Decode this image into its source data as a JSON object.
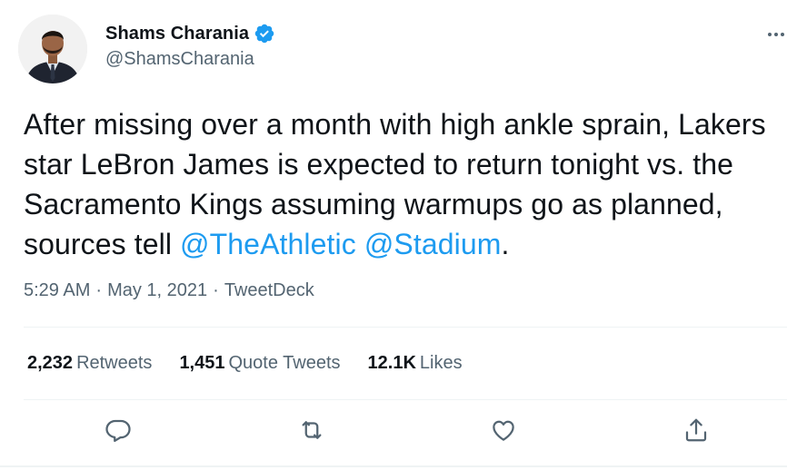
{
  "author": {
    "name": "Shams Charania",
    "handle": "@ShamsCharania",
    "verified": true
  },
  "tweet": {
    "text_parts": [
      "After missing over a month with high ankle sprain, Lakers star LeBron James is expected to return tonight vs. the Sacramento Kings assuming warmups go as planned, sources tell ",
      "@TheAthletic",
      " ",
      "@Stadium",
      "."
    ]
  },
  "meta": {
    "time": "5:29 AM",
    "separator": "·",
    "date": "May 1, 2021",
    "source": "TweetDeck"
  },
  "stats": {
    "retweets_count": "2,232",
    "retweets_label": "Retweets",
    "quotes_count": "1,451",
    "quotes_label": "Quote Tweets",
    "likes_count": "12.1K",
    "likes_label": "Likes"
  },
  "icons": {
    "verified": "verified-badge-icon",
    "more": "more-icon",
    "reply": "reply-icon",
    "retweet": "retweet-icon",
    "like": "like-icon",
    "share": "share-icon"
  },
  "colors": {
    "text": "#0f1419",
    "secondary": "#536471",
    "accent": "#1d9bf0",
    "divider": "#eff3f4"
  }
}
